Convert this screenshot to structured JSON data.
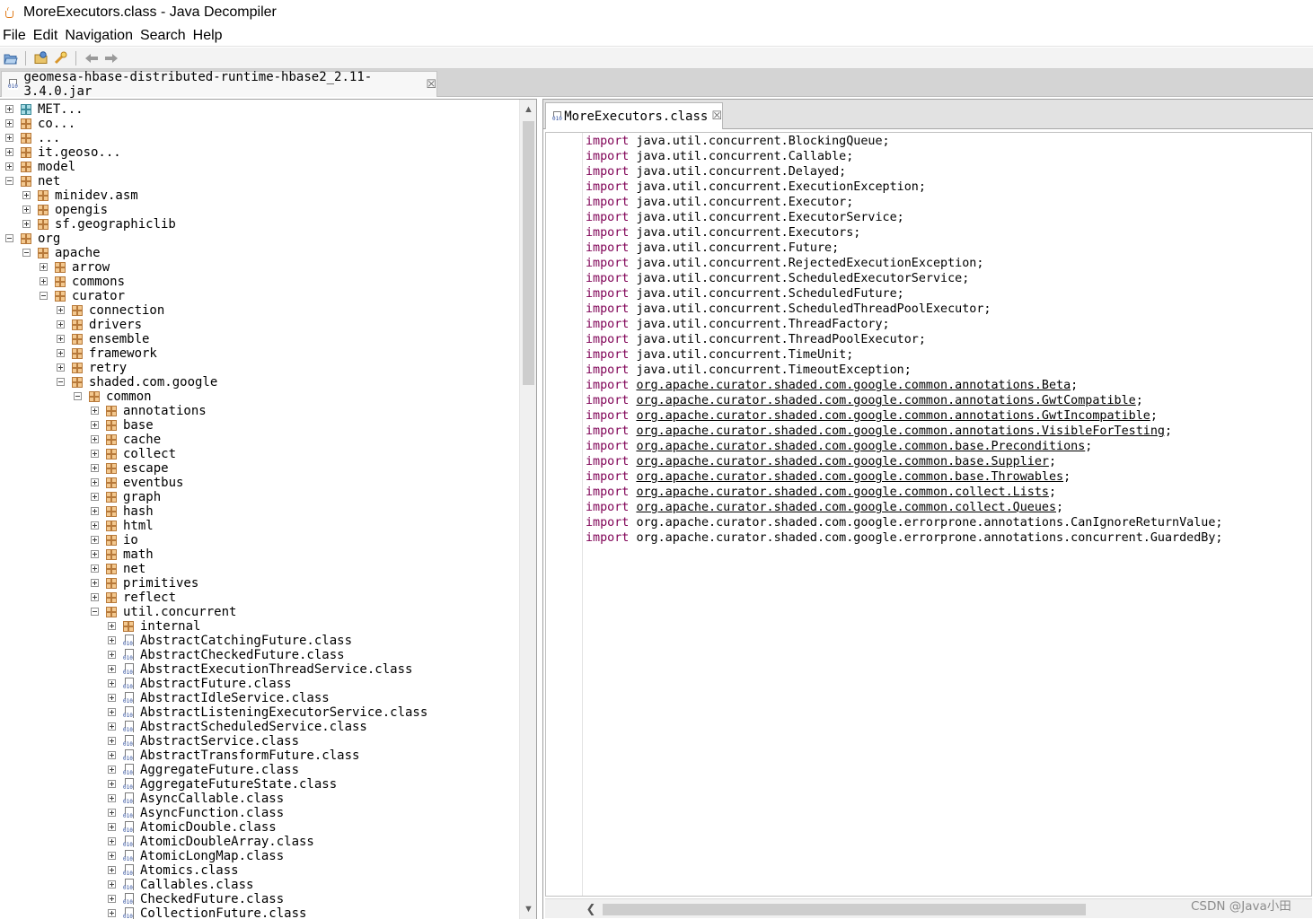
{
  "window": {
    "title": "MoreExecutors.class - Java Decompiler"
  },
  "menu": [
    "File",
    "Edit",
    "Navigation",
    "Search",
    "Help"
  ],
  "toolbar": {
    "icons": [
      "open-file-icon",
      "open-type-icon",
      "search-type-icon",
      "back-icon",
      "forward-icon"
    ]
  },
  "archive_tab": {
    "label": "geomesa-hbase-distributed-runtime-hbase2_2.11-3.4.0.jar",
    "close_glyph": "☒"
  },
  "tree": [
    {
      "depth": 0,
      "kind": "package-cyan",
      "expanded": false,
      "label": "MET..."
    },
    {
      "depth": 0,
      "kind": "package",
      "expanded": false,
      "label": "co..."
    },
    {
      "depth": 0,
      "kind": "package",
      "expanded": false,
      "label": "..."
    },
    {
      "depth": 0,
      "kind": "package",
      "expanded": false,
      "label": "it.geoso..."
    },
    {
      "depth": 0,
      "kind": "package",
      "expanded": false,
      "label": "model"
    },
    {
      "depth": 0,
      "kind": "package",
      "expanded": true,
      "label": "net"
    },
    {
      "depth": 1,
      "kind": "package",
      "expanded": false,
      "label": "minidev.asm"
    },
    {
      "depth": 1,
      "kind": "package",
      "expanded": false,
      "label": "opengis"
    },
    {
      "depth": 1,
      "kind": "package",
      "expanded": false,
      "label": "sf.geographiclib"
    },
    {
      "depth": 0,
      "kind": "package",
      "expanded": true,
      "label": "org"
    },
    {
      "depth": 1,
      "kind": "package",
      "expanded": true,
      "label": "apache"
    },
    {
      "depth": 2,
      "kind": "package",
      "expanded": false,
      "label": "arrow"
    },
    {
      "depth": 2,
      "kind": "package",
      "expanded": false,
      "label": "commons"
    },
    {
      "depth": 2,
      "kind": "package",
      "expanded": true,
      "label": "curator"
    },
    {
      "depth": 3,
      "kind": "package",
      "expanded": false,
      "label": "connection"
    },
    {
      "depth": 3,
      "kind": "package",
      "expanded": false,
      "label": "drivers"
    },
    {
      "depth": 3,
      "kind": "package",
      "expanded": false,
      "label": "ensemble"
    },
    {
      "depth": 3,
      "kind": "package",
      "expanded": false,
      "label": "framework"
    },
    {
      "depth": 3,
      "kind": "package",
      "expanded": false,
      "label": "retry"
    },
    {
      "depth": 3,
      "kind": "package",
      "expanded": true,
      "label": "shaded.com.google"
    },
    {
      "depth": 4,
      "kind": "package",
      "expanded": true,
      "label": "common"
    },
    {
      "depth": 5,
      "kind": "package",
      "expanded": false,
      "label": "annotations"
    },
    {
      "depth": 5,
      "kind": "package",
      "expanded": false,
      "label": "base"
    },
    {
      "depth": 5,
      "kind": "package",
      "expanded": false,
      "label": "cache"
    },
    {
      "depth": 5,
      "kind": "package",
      "expanded": false,
      "label": "collect"
    },
    {
      "depth": 5,
      "kind": "package",
      "expanded": false,
      "label": "escape"
    },
    {
      "depth": 5,
      "kind": "package",
      "expanded": false,
      "label": "eventbus"
    },
    {
      "depth": 5,
      "kind": "package",
      "expanded": false,
      "label": "graph"
    },
    {
      "depth": 5,
      "kind": "package",
      "expanded": false,
      "label": "hash"
    },
    {
      "depth": 5,
      "kind": "package",
      "expanded": false,
      "label": "html"
    },
    {
      "depth": 5,
      "kind": "package",
      "expanded": false,
      "label": "io"
    },
    {
      "depth": 5,
      "kind": "package",
      "expanded": false,
      "label": "math"
    },
    {
      "depth": 5,
      "kind": "package",
      "expanded": false,
      "label": "net"
    },
    {
      "depth": 5,
      "kind": "package",
      "expanded": false,
      "label": "primitives"
    },
    {
      "depth": 5,
      "kind": "package",
      "expanded": false,
      "label": "reflect"
    },
    {
      "depth": 5,
      "kind": "package",
      "expanded": true,
      "label": "util.concurrent"
    },
    {
      "depth": 6,
      "kind": "package",
      "expanded": false,
      "label": "internal"
    },
    {
      "depth": 6,
      "kind": "class",
      "expanded": false,
      "label": "AbstractCatchingFuture.class"
    },
    {
      "depth": 6,
      "kind": "class",
      "expanded": false,
      "label": "AbstractCheckedFuture.class"
    },
    {
      "depth": 6,
      "kind": "class",
      "expanded": false,
      "label": "AbstractExecutionThreadService.class"
    },
    {
      "depth": 6,
      "kind": "class",
      "expanded": false,
      "label": "AbstractFuture.class"
    },
    {
      "depth": 6,
      "kind": "class",
      "expanded": false,
      "label": "AbstractIdleService.class"
    },
    {
      "depth": 6,
      "kind": "class",
      "expanded": false,
      "label": "AbstractListeningExecutorService.class"
    },
    {
      "depth": 6,
      "kind": "class",
      "expanded": false,
      "label": "AbstractScheduledService.class"
    },
    {
      "depth": 6,
      "kind": "class",
      "expanded": false,
      "label": "AbstractService.class"
    },
    {
      "depth": 6,
      "kind": "class",
      "expanded": false,
      "label": "AbstractTransformFuture.class"
    },
    {
      "depth": 6,
      "kind": "class",
      "expanded": false,
      "label": "AggregateFuture.class"
    },
    {
      "depth": 6,
      "kind": "class",
      "expanded": false,
      "label": "AggregateFutureState.class"
    },
    {
      "depth": 6,
      "kind": "class",
      "expanded": false,
      "label": "AsyncCallable.class"
    },
    {
      "depth": 6,
      "kind": "class",
      "expanded": false,
      "label": "AsyncFunction.class"
    },
    {
      "depth": 6,
      "kind": "class",
      "expanded": false,
      "label": "AtomicDouble.class"
    },
    {
      "depth": 6,
      "kind": "class",
      "expanded": false,
      "label": "AtomicDoubleArray.class"
    },
    {
      "depth": 6,
      "kind": "class",
      "expanded": false,
      "label": "AtomicLongMap.class"
    },
    {
      "depth": 6,
      "kind": "class",
      "expanded": false,
      "label": "Atomics.class"
    },
    {
      "depth": 6,
      "kind": "class",
      "expanded": false,
      "label": "Callables.class"
    },
    {
      "depth": 6,
      "kind": "class",
      "expanded": false,
      "label": "CheckedFuture.class"
    },
    {
      "depth": 6,
      "kind": "class",
      "expanded": false,
      "label": "CollectionFuture.class"
    }
  ],
  "editor": {
    "tab_label": "MoreExecutors.class",
    "close_glyph": "☒",
    "keyword": "import",
    "lines": [
      {
        "target": "java.util.concurrent.BlockingQueue",
        "linked": false
      },
      {
        "target": "java.util.concurrent.Callable",
        "linked": false
      },
      {
        "target": "java.util.concurrent.Delayed",
        "linked": false
      },
      {
        "target": "java.util.concurrent.ExecutionException",
        "linked": false
      },
      {
        "target": "java.util.concurrent.Executor",
        "linked": false
      },
      {
        "target": "java.util.concurrent.ExecutorService",
        "linked": false
      },
      {
        "target": "java.util.concurrent.Executors",
        "linked": false
      },
      {
        "target": "java.util.concurrent.Future",
        "linked": false
      },
      {
        "target": "java.util.concurrent.RejectedExecutionException",
        "linked": false
      },
      {
        "target": "java.util.concurrent.ScheduledExecutorService",
        "linked": false
      },
      {
        "target": "java.util.concurrent.ScheduledFuture",
        "linked": false
      },
      {
        "target": "java.util.concurrent.ScheduledThreadPoolExecutor",
        "linked": false
      },
      {
        "target": "java.util.concurrent.ThreadFactory",
        "linked": false
      },
      {
        "target": "java.util.concurrent.ThreadPoolExecutor",
        "linked": false
      },
      {
        "target": "java.util.concurrent.TimeUnit",
        "linked": false
      },
      {
        "target": "java.util.concurrent.TimeoutException",
        "linked": false
      },
      {
        "target": "org.apache.curator.shaded.com.google.common.annotations.Beta",
        "linked": true
      },
      {
        "target": "org.apache.curator.shaded.com.google.common.annotations.GwtCompatible",
        "linked": true
      },
      {
        "target": "org.apache.curator.shaded.com.google.common.annotations.GwtIncompatible",
        "linked": true
      },
      {
        "target": "org.apache.curator.shaded.com.google.common.annotations.VisibleForTesting",
        "linked": true
      },
      {
        "target": "org.apache.curator.shaded.com.google.common.base.Preconditions",
        "linked": true
      },
      {
        "target": "org.apache.curator.shaded.com.google.common.base.Supplier",
        "linked": true
      },
      {
        "target": "org.apache.curator.shaded.com.google.common.base.Throwables",
        "linked": true
      },
      {
        "target": "org.apache.curator.shaded.com.google.common.collect.Lists",
        "linked": true
      },
      {
        "target": "org.apache.curator.shaded.com.google.common.collect.Queues",
        "linked": true
      },
      {
        "target": "org.apache.curator.shaded.com.google.errorprone.annotations.CanIgnoreReturnValue",
        "linked": false
      },
      {
        "target": "org.apache.curator.shaded.com.google.errorprone.annotations.concurrent.GuardedBy",
        "linked": false
      }
    ]
  },
  "watermark": "CSDN @Java小田",
  "colors": {
    "keyword": "#7f0055",
    "package_icon": "#f3c88f",
    "meta_package_icon": "#a7dbe4"
  }
}
